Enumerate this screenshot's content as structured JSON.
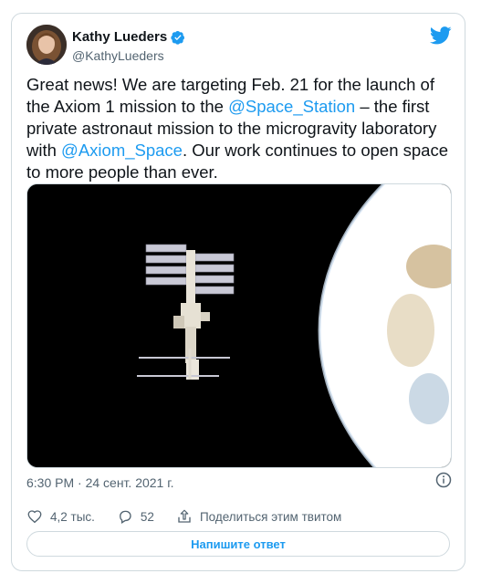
{
  "author": {
    "name": "Kathy Lueders",
    "handle": "@KathyLueders",
    "verified": true
  },
  "tweet": {
    "text_1": "Great news! We are targeting Feb. 21 for the launch of the Axiom 1 mission to the ",
    "mention_1": "@Space_Station",
    "text_2": " – the first private astronaut mission to the microgravity laboratory with ",
    "mention_2": "@Axiom_Space",
    "text_3": ". Our work continues to open space to more people than ever."
  },
  "meta": {
    "timestamp": "6:30 PM · 24 сент. 2021 г."
  },
  "actions": {
    "likes": "4,2 тыс.",
    "replies": "52",
    "share": "Поделиться этим твитом"
  },
  "reply_button": "Напишите ответ",
  "colors": {
    "accent": "#1d9bf0",
    "text": "#0f1419",
    "muted": "#536471",
    "border": "#cfd9de"
  },
  "icons": [
    "verified-badge-icon",
    "twitter-bird-icon",
    "info-icon",
    "heart-icon",
    "reply-icon",
    "share-icon"
  ]
}
